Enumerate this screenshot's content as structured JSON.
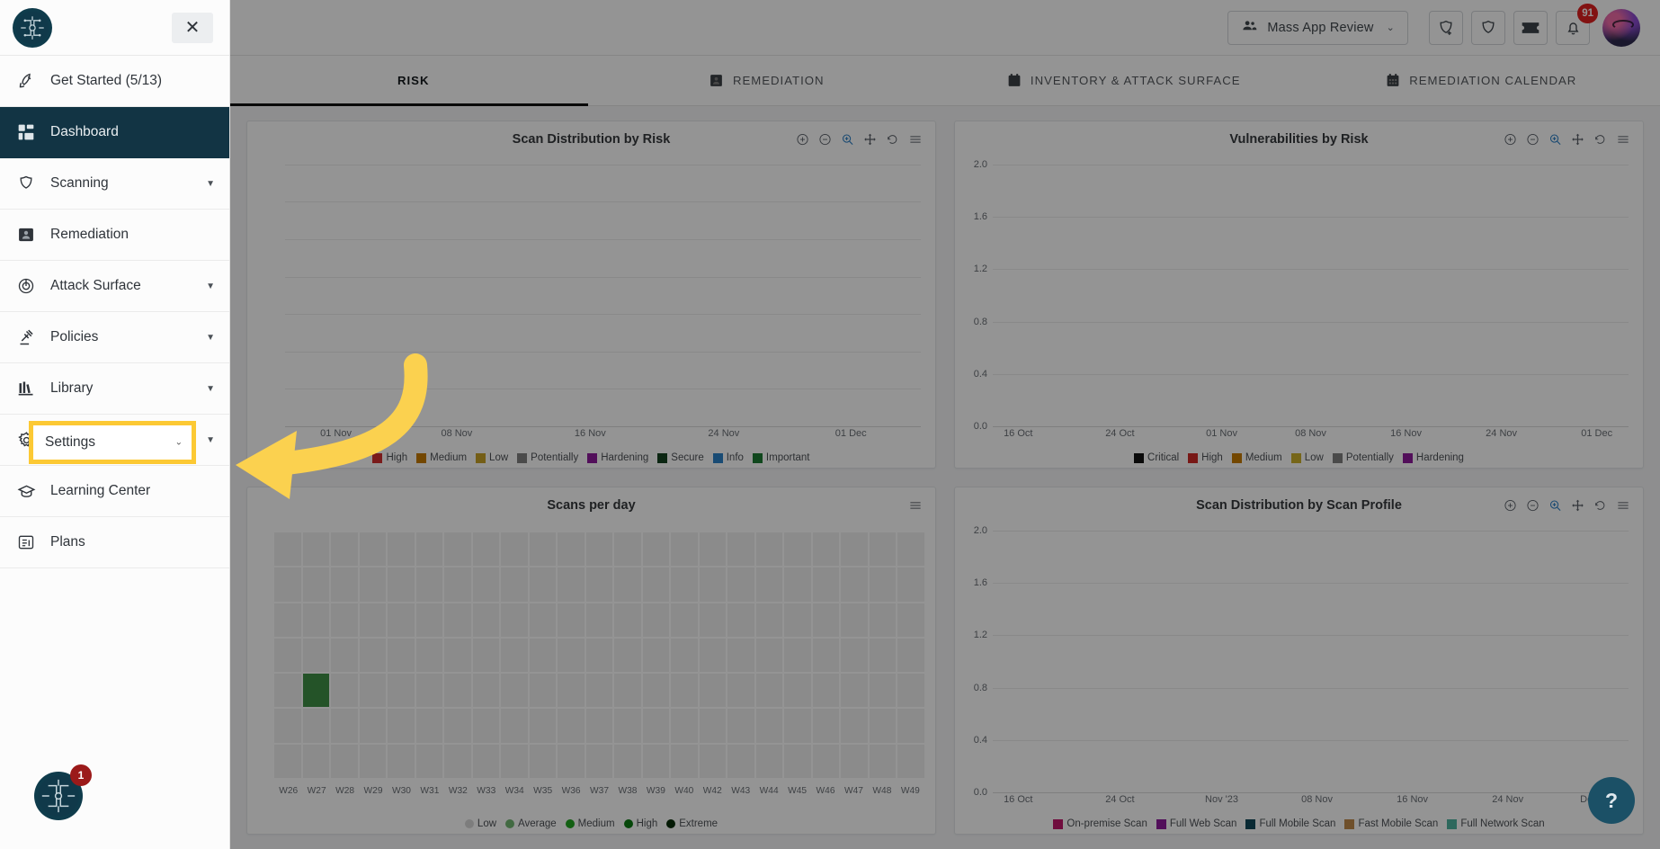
{
  "topbar": {
    "org_selector": {
      "label": "Mass App Review",
      "icon": "people-icon",
      "caret": "⌄"
    },
    "actions": [
      {
        "name": "add-shield-icon",
        "label": "Add Target"
      },
      {
        "name": "shield-icon",
        "label": "Security"
      },
      {
        "name": "support-ticket-icon",
        "label": "Support"
      },
      {
        "name": "bell-icon",
        "label": "Notifications",
        "badge": "91"
      }
    ],
    "avatar_label": "User Avatar"
  },
  "tabs": [
    {
      "label": "RISK",
      "icon": "risk-icon",
      "active": true
    },
    {
      "label": "REMEDIATION",
      "icon": "remediation-icon",
      "active": false
    },
    {
      "label": "INVENTORY & ATTACK SURFACE",
      "icon": "inventory-icon",
      "active": false
    },
    {
      "label": "REMEDIATION CALENDAR",
      "icon": "calendar-icon",
      "active": false
    }
  ],
  "drawer": {
    "close_label": "✕",
    "items": [
      {
        "label": "Get Started (5/13)",
        "icon": "rocket-icon",
        "active": false,
        "caret": false
      },
      {
        "label": "Dashboard",
        "icon": "dashboard-icon",
        "active": true,
        "caret": false
      },
      {
        "label": "Scanning",
        "icon": "shield-icon",
        "active": false,
        "caret": true
      },
      {
        "label": "Remediation",
        "icon": "remediation-icon",
        "active": false,
        "caret": false
      },
      {
        "label": "Attack Surface",
        "icon": "target-icon",
        "active": false,
        "caret": true
      },
      {
        "label": "Policies",
        "icon": "gavel-icon",
        "active": false,
        "caret": true
      },
      {
        "label": "Library",
        "icon": "library-icon",
        "active": false,
        "caret": true
      },
      {
        "label": "Settings",
        "icon": "gear-icon",
        "active": false,
        "caret": true
      },
      {
        "label": "Learning Center",
        "icon": "graduation-icon",
        "active": false,
        "caret": false
      },
      {
        "label": "Plans",
        "icon": "plans-icon",
        "active": false,
        "caret": false
      }
    ],
    "highlight": {
      "label": "Settings",
      "border_color": "#fcc934",
      "caret": "⌄"
    },
    "footer_badge": "1"
  },
  "help_fab": {
    "label": "?"
  },
  "chart_tools": [
    "zoom-in-icon",
    "zoom-out-icon",
    "selection-zoom-icon",
    "panning-icon",
    "reset-icon",
    "menu-icon"
  ],
  "chart_data": [
    {
      "type": "area",
      "title": "Scan Distribution by Risk",
      "x": [
        "01 Nov",
        "08 Nov",
        "16 Nov",
        "24 Nov",
        "01 Dec"
      ],
      "xlabel": "",
      "ylabel": "",
      "grid": true,
      "legend_position": "bottom",
      "series": [
        {
          "name": "High",
          "color": "#d32f2f",
          "values": [
            0,
            0,
            0,
            0,
            0
          ]
        },
        {
          "name": "Medium",
          "color": "#c77b00",
          "values": [
            0,
            0,
            0,
            0,
            0
          ]
        },
        {
          "name": "Low",
          "color": "#c9a227",
          "values": [
            0,
            0,
            0,
            0,
            0
          ]
        },
        {
          "name": "Potentially",
          "color": "#808080",
          "values": [
            0,
            0,
            0,
            0,
            0
          ]
        },
        {
          "name": "Hardening",
          "color": "#8e1a9c",
          "values": [
            0,
            0,
            0,
            0,
            0
          ]
        },
        {
          "name": "Secure",
          "color": "#14431f",
          "values": [
            0,
            0,
            0,
            0,
            0
          ]
        },
        {
          "name": "Info",
          "color": "#2c82c9",
          "values": [
            0,
            0,
            0,
            0,
            0
          ]
        },
        {
          "name": "Important",
          "color": "#1d7a33",
          "values": [
            0,
            0,
            0,
            0,
            0
          ]
        }
      ]
    },
    {
      "type": "area",
      "title": "Vulnerabilities by Risk",
      "x": [
        "16 Oct",
        "24 Oct",
        "01 Nov",
        "08 Nov",
        "16 Nov",
        "24 Nov",
        "01 Dec"
      ],
      "yticks": [
        "0.0",
        "0.4",
        "0.8",
        "1.2",
        "1.6",
        "2.0"
      ],
      "ylim": [
        0,
        2
      ],
      "grid": true,
      "legend_position": "bottom",
      "series": [
        {
          "name": "Critical",
          "color": "#121212",
          "values": [
            0,
            0,
            0,
            0,
            0,
            0,
            0
          ]
        },
        {
          "name": "High",
          "color": "#cf2a27",
          "values": [
            0,
            0,
            0,
            0,
            0,
            0,
            0
          ]
        },
        {
          "name": "Medium",
          "color": "#c77b00",
          "values": [
            0,
            0,
            0,
            0,
            0,
            0,
            0
          ]
        },
        {
          "name": "Low",
          "color": "#cbb02c",
          "values": [
            0,
            0,
            0,
            0,
            0,
            0,
            0
          ]
        },
        {
          "name": "Potentially",
          "color": "#808080",
          "values": [
            0,
            0,
            0,
            0,
            0,
            0,
            0
          ]
        },
        {
          "name": "Hardening",
          "color": "#8e1a9c",
          "values": [
            0,
            0,
            0,
            0,
            0,
            0,
            0
          ]
        }
      ]
    },
    {
      "type": "heatmap",
      "title": "Scans per day",
      "x": [
        "W26",
        "W27",
        "W28",
        "W29",
        "W30",
        "W31",
        "W32",
        "W33",
        "W34",
        "W35",
        "W36",
        "W37",
        "W38",
        "W39",
        "W40",
        "W42",
        "W43",
        "W44",
        "W45",
        "W46",
        "W47",
        "W48",
        "W49"
      ],
      "rows": 7,
      "filled_cells": [
        {
          "col": 1,
          "row": 4,
          "level": "Medium",
          "color": "#3f8f46"
        }
      ],
      "legend_position": "bottom",
      "legend": [
        {
          "name": "Low",
          "color": "#d7d7d7"
        },
        {
          "name": "Average",
          "color": "#72b772"
        },
        {
          "name": "Medium",
          "color": "#22a522"
        },
        {
          "name": "High",
          "color": "#0c7a12"
        },
        {
          "name": "Extreme",
          "color": "#072e09"
        }
      ]
    },
    {
      "type": "area",
      "title": "Scan Distribution by Scan Profile",
      "x": [
        "16 Oct",
        "24 Oct",
        "Nov '23",
        "08 Nov",
        "16 Nov",
        "24 Nov",
        "Dec '23"
      ],
      "yticks": [
        "0.0",
        "0.4",
        "0.8",
        "1.2",
        "1.6",
        "2.0"
      ],
      "ylim": [
        0,
        2
      ],
      "grid": true,
      "legend_position": "bottom",
      "series": [
        {
          "name": "On-premise Scan",
          "color": "#c2186b",
          "values": [
            0,
            0,
            0,
            0,
            0,
            0,
            0
          ]
        },
        {
          "name": "Full Web Scan",
          "color": "#8e1a9c",
          "values": [
            0,
            0,
            0,
            0,
            0,
            0,
            0
          ]
        },
        {
          "name": "Full Mobile Scan",
          "color": "#11495b",
          "values": [
            0,
            0,
            0,
            0,
            0,
            0,
            0
          ]
        },
        {
          "name": "Fast Mobile Scan",
          "color": "#c08a4a",
          "values": [
            0,
            0,
            0,
            0,
            0,
            0,
            0
          ]
        },
        {
          "name": "Full Network Scan",
          "color": "#4fb3a0",
          "values": [
            0,
            0,
            0,
            0,
            0,
            0,
            0
          ]
        }
      ]
    }
  ]
}
